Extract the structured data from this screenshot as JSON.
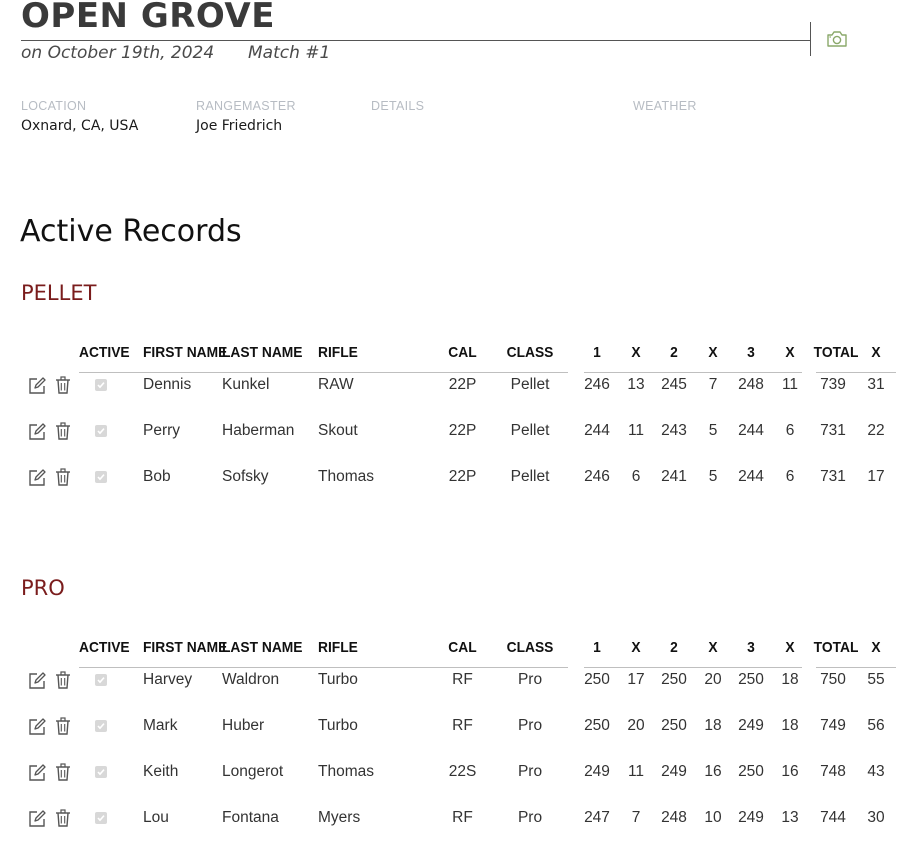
{
  "header": {
    "title": "OPEN GROVE",
    "date_text": "on October 19th, 2024",
    "match_text": "Match #1"
  },
  "info": {
    "location_label": "LOCATION",
    "location_value": "Oxnard, CA, USA",
    "rangemaster_label": "RANGEMASTER",
    "rangemaster_value": "Joe Friedrich",
    "details_label": "DETAILS",
    "weather_label": "WEATHER"
  },
  "section_title": "Active Records",
  "columns": [
    "ACTIVE",
    "FIRST NAME",
    "LAST NAME",
    "RIFLE",
    "CAL",
    "CLASS",
    "1",
    "X",
    "2",
    "X",
    "3",
    "X",
    "TOTAL",
    "X"
  ],
  "groups": [
    {
      "title": "PELLET",
      "rows": [
        {
          "first": "Dennis",
          "last": "Kunkel",
          "rifle": "RAW",
          "cal": "22P",
          "class": "Pellet",
          "s1": "246",
          "x1": "13",
          "s2": "245",
          "x2": "7",
          "s3": "248",
          "x3": "11",
          "total": "739",
          "xt": "31"
        },
        {
          "first": "Perry",
          "last": "Haberman",
          "rifle": "Skout",
          "cal": "22P",
          "class": "Pellet",
          "s1": "244",
          "x1": "11",
          "s2": "243",
          "x2": "5",
          "s3": "244",
          "x3": "6",
          "total": "731",
          "xt": "22"
        },
        {
          "first": "Bob",
          "last": "Sofsky",
          "rifle": "Thomas",
          "cal": "22P",
          "class": "Pellet",
          "s1": "246",
          "x1": "6",
          "s2": "241",
          "x2": "5",
          "s3": "244",
          "x3": "6",
          "total": "731",
          "xt": "17"
        }
      ]
    },
    {
      "title": "PRO",
      "rows": [
        {
          "first": "Harvey",
          "last": "Waldron",
          "rifle": "Turbo",
          "cal": "RF",
          "class": "Pro",
          "s1": "250",
          "x1": "17",
          "s2": "250",
          "x2": "20",
          "s3": "250",
          "x3": "18",
          "total": "750",
          "xt": "55"
        },
        {
          "first": "Mark",
          "last": "Huber",
          "rifle": "Turbo",
          "cal": "RF",
          "class": "Pro",
          "s1": "250",
          "x1": "20",
          "s2": "250",
          "x2": "18",
          "s3": "249",
          "x3": "18",
          "total": "749",
          "xt": "56"
        },
        {
          "first": "Keith",
          "last": "Longerot",
          "rifle": "Thomas",
          "cal": "22S",
          "class": "Pro",
          "s1": "249",
          "x1": "11",
          "s2": "249",
          "x2": "16",
          "s3": "250",
          "x3": "16",
          "total": "748",
          "xt": "43"
        },
        {
          "first": "Lou",
          "last": "Fontana",
          "rifle": "Myers",
          "cal": "RF",
          "class": "Pro",
          "s1": "247",
          "x1": "7",
          "s2": "248",
          "x2": "10",
          "s3": "249",
          "x3": "13",
          "total": "744",
          "xt": "30"
        }
      ]
    }
  ],
  "colors": {
    "group_title": "#7a1c1c",
    "label_gray": "#b7bcc3",
    "camera_icon": "#8aa86a"
  }
}
